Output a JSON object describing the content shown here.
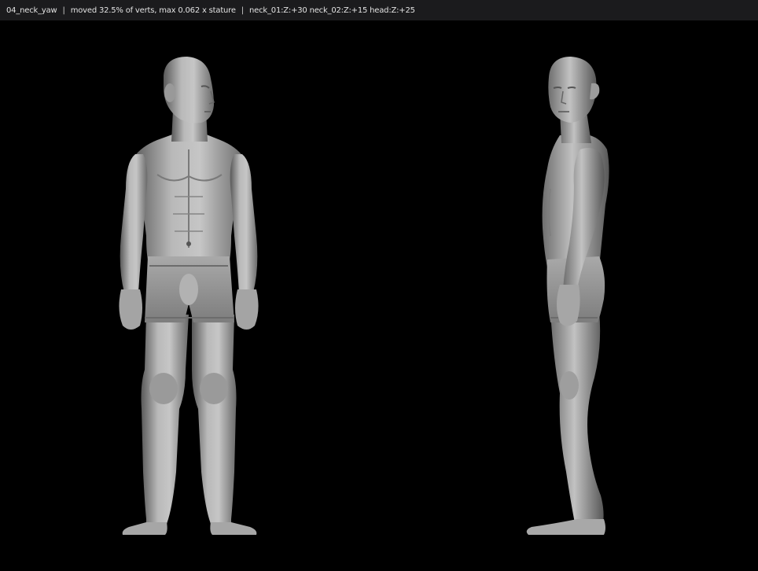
{
  "header": {
    "step": "04_neck_yaw",
    "separator": "|",
    "stats": "moved 32.5% of verts, max 0.062 x stature",
    "rotations": "neck_01:Z:+30 neck_02:Z:+15 head:Z:+25"
  },
  "colors": {
    "bar_background": "#1b1b1d",
    "bar_text": "#e2e2e2",
    "viewport_background": "#000000",
    "mesh_light": "#c4c4c4",
    "mesh_mid": "#8e8e8e",
    "mesh_dark": "#4a4a4a"
  },
  "views": [
    {
      "name": "front-view"
    },
    {
      "name": "side-view"
    }
  ]
}
